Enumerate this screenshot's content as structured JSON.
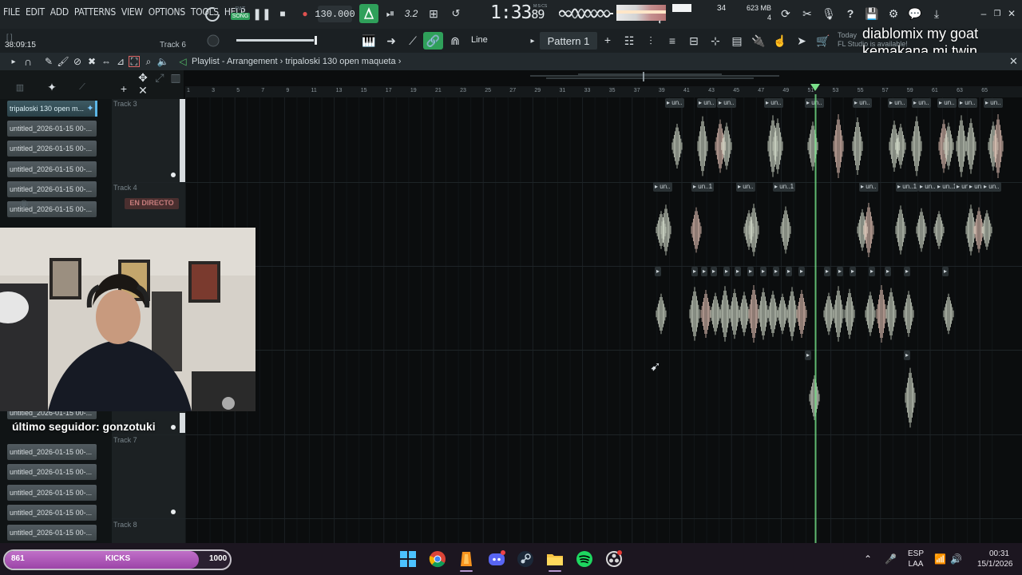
{
  "menu": [
    "FILE",
    "EDIT",
    "ADD",
    "PATTERNS",
    "VIEW",
    "OPTIONS",
    "TOOLS",
    "HELP"
  ],
  "transport": {
    "pat_label": "PAT",
    "song_label": "SONG",
    "tempo": "130.000",
    "time_sig_display": "3.2",
    "clock_main": "1:33",
    "clock_fraction": "89",
    "clock_mode": "M:S:CS"
  },
  "monitors": {
    "cpu_value": "34",
    "memory": "623 MB",
    "memory_sub": "4"
  },
  "toolbar2": {
    "time_readout": "38:09:15",
    "track_hint": "Track 6",
    "bracket_hint": "[  ]",
    "snap_label": "Line",
    "pattern_label": "Pattern 1",
    "today_hint": "Today",
    "update_hint": "FL Studio is available!"
  },
  "overlay_message": "diablomix my goat kemakana mi twin",
  "playlist": {
    "title_prefix": "Playlist - Arrangement",
    "separator": "›",
    "project": "tripaloski 130 open maqueta",
    "close": "✕"
  },
  "bar_numbers": [
    "1",
    "3",
    "5",
    "7",
    "9",
    "11",
    "13",
    "15",
    "17",
    "19",
    "21",
    "23",
    "25",
    "27",
    "29",
    "31",
    "33",
    "35",
    "37",
    "39",
    "41",
    "43",
    "45",
    "47",
    "49",
    "51",
    "53",
    "55",
    "57",
    "59",
    "61",
    "63",
    "65"
  ],
  "clip_list": [
    "tripaloski 130 open m...",
    "untitled_2026-01-15 00-...",
    "untitled_2026-01-15 00-...",
    "untitled_2026-01-15 00-...",
    "untitled_2026-01-15 00-...",
    "untitled_2026-01-15 00-...",
    "untitled_2026-01-15 00-...",
    "untitled_2026-01-15 00-...",
    "untitled_2026-01-15 00-...",
    "untitled_2026-01-15 00-..."
  ],
  "tracks": [
    "Track 3",
    "Track 4",
    "Track 7",
    "Track 8"
  ],
  "clip_tags": [
    "un..",
    "un..1",
    "un"
  ],
  "stream": {
    "live_badge": "EN DIRECTO",
    "follower": "último seguidor: gonzotuki",
    "goal_current": "861",
    "goal_label": "KICKS",
    "goal_target": "1000",
    "goal_progress": 0.861
  },
  "tray": {
    "language": "ESP",
    "layout": "LAA",
    "time": "00:31",
    "date": "15/1/2026"
  },
  "colors": {
    "accent_green": "#2fa05a",
    "playhead": "#7be08a",
    "goal_fill": "#b057bb",
    "panel_bg": "#1f2427"
  }
}
